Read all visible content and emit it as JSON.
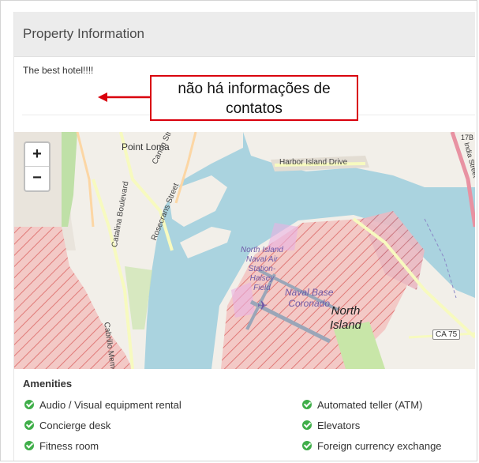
{
  "panel": {
    "title": "Property Information",
    "description": "The best hotel!!!!"
  },
  "callout": {
    "line1": "não há informações de",
    "line2": "contatos",
    "border_color": "#d9000d"
  },
  "map": {
    "zoom_in": "+",
    "zoom_out": "−",
    "labels": {
      "point_loma": "Point Loma",
      "canon_street": "Canon Street",
      "harbor_island": "Harbor Island Drive",
      "catalina": "Catalina Boulevard",
      "rosecrans": "Rosecrans Street",
      "cabrillo": "Cabrillo Memorial Dr",
      "nasni_1": "North Island",
      "nasni_2": "Naval Air",
      "nasni_3": "Station-",
      "nasni_4": "Halsey",
      "nasni_5": "Field",
      "naval_base_1": "Naval Base",
      "naval_base_2": "Coronado",
      "north_island_1": "North",
      "north_island_2": "Island",
      "ca75": "CA 75",
      "exit17b": "17B",
      "exit_vert": "India Street"
    },
    "colors": {
      "water": "#aad3df",
      "land": "#f2efe9",
      "military": "#f2c6c6",
      "park": "#c8e6a8"
    }
  },
  "amenities": {
    "title": "Amenities",
    "left": [
      "Audio / Visual equipment rental",
      "Concierge desk",
      "Fitness room"
    ],
    "right": [
      "Automated teller (ATM)",
      "Elevators",
      "Foreign currency exchange"
    ]
  }
}
